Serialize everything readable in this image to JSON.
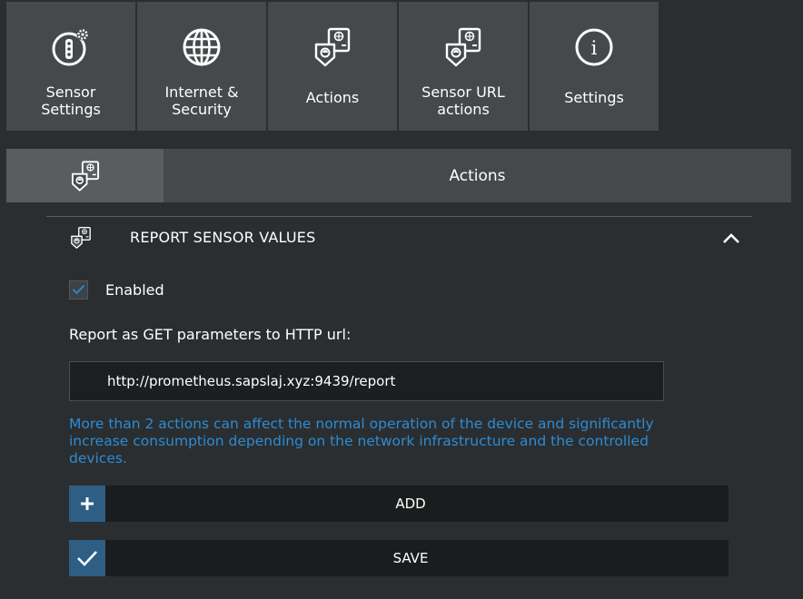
{
  "nav": {
    "tiles": [
      {
        "label": "Sensor\nSettings",
        "icon": "sensor-settings-icon"
      },
      {
        "label": "Internet &\nSecurity",
        "icon": "globe-icon"
      },
      {
        "label": "Actions",
        "icon": "actions-icon"
      },
      {
        "label": "Sensor URL\nactions",
        "icon": "sensor-url-actions-icon"
      },
      {
        "label": "Settings",
        "icon": "info-icon"
      }
    ]
  },
  "section": {
    "title": "Actions",
    "icon": "actions-icon"
  },
  "panel": {
    "title": "REPORT SENSOR VALUES",
    "icon": "actions-icon",
    "collapse_icon": "chevron-up-icon",
    "enabled_label": "Enabled",
    "enabled_checked": true,
    "url_label": "Report as GET parameters to HTTP url:",
    "url_value": "http://prometheus.sapslaj.xyz:9439/report",
    "warning": "More than 2 actions can affect the normal operation of the device and significantly increase consumption depending on the network infrastructure and the controlled devices."
  },
  "buttons": {
    "add_label": "ADD",
    "add_icon": "plus-icon",
    "save_label": "SAVE",
    "save_icon": "checkmark-icon"
  },
  "colors": {
    "background": "#2a2e30",
    "tile": "#45494b",
    "accent": "#2f5e85",
    "warning_text": "#2e8bd3"
  }
}
